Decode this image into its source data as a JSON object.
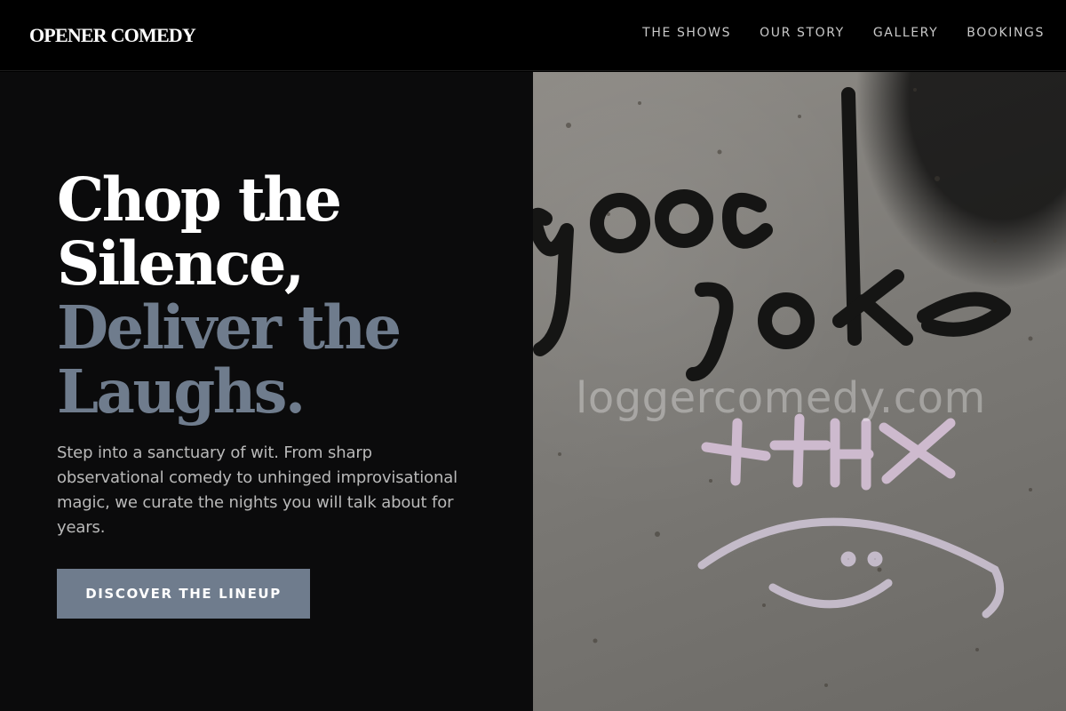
{
  "header": {
    "logo": "OPENER COMEDY",
    "nav": [
      "THE SHOWS",
      "OUR STORY",
      "GALLERY",
      "BOOKINGS"
    ]
  },
  "hero": {
    "headline_line1": "Chop the",
    "headline_line2": "Silence,",
    "headline_line3": "Deliver the",
    "headline_line4": "Laughs.",
    "lede": "Step into a sanctuary of wit. From sharp observational comedy to unhinged improvisational magic, we curate the nights you will talk about for years.",
    "cta_label": "DISCOVER THE LINEUP"
  },
  "image": {
    "graffiti_text_1": "good",
    "graffiti_text_2": "joke",
    "graffiti_text_3": "+thx",
    "watermark": "loggercomedy.com"
  },
  "colors": {
    "background": "#0b0b0c",
    "accent": "#6f7c8d",
    "text_primary": "#ffffff",
    "text_secondary": "#b9b9b9"
  }
}
